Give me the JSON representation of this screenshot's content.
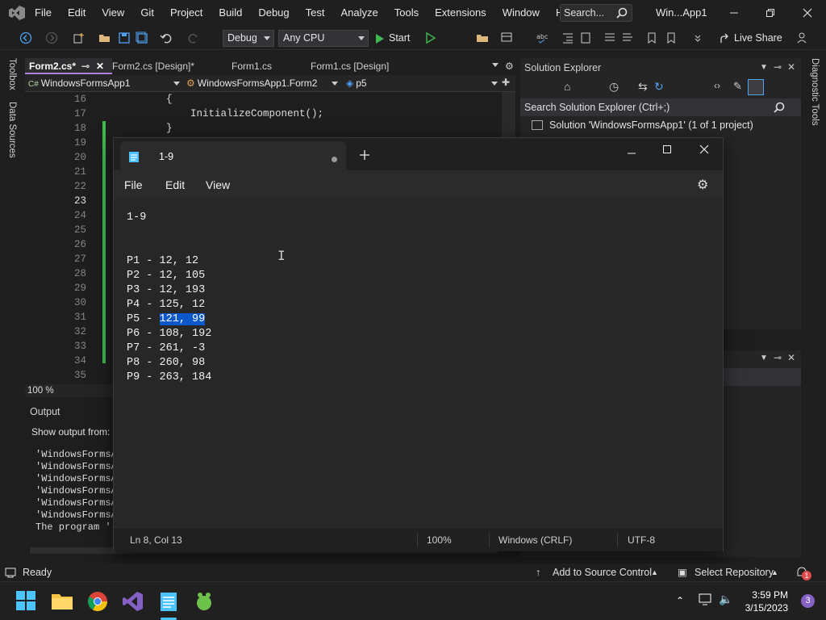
{
  "vs": {
    "menu": [
      "File",
      "Edit",
      "View",
      "Git",
      "Project",
      "Build",
      "Debug",
      "Test",
      "Analyze",
      "Tools",
      "Extensions",
      "Window",
      "Help"
    ],
    "search_placeholder": "Search...",
    "window_title": "Win...App1",
    "config": "Debug",
    "platform": "Any CPU",
    "start_label": "Start",
    "live_share": "Live Share",
    "left_rail": [
      "Toolbox",
      "Data Sources"
    ],
    "right_rail": [
      "Diagnostic Tools"
    ],
    "tabs": [
      "Form2.cs*",
      "Form2.cs [Design]*",
      "Form1.cs",
      "Form1.cs [Design]"
    ],
    "nav": {
      "project": "WindowsFormsApp1",
      "class": "WindowsFormsApp1.Form2",
      "member": "p5"
    },
    "line_numbers": [
      "16",
      "17",
      "18",
      "19",
      "20",
      "21",
      "22",
      "23",
      "24",
      "25",
      "26",
      "27",
      "28",
      "29",
      "30",
      "31",
      "32",
      "33",
      "34",
      "35"
    ],
    "current_line": "23",
    "code": [
      {
        "line": "16",
        "text": "{"
      },
      {
        "line": "17",
        "text": "    InitializeComponent();"
      },
      {
        "line": "18",
        "text": "}"
      }
    ],
    "zoom": "100 %",
    "output": {
      "title": "Output",
      "show_from": "Show output from:",
      "lines": [
        "'WindowsFormsA",
        "'WindowsFormsA",
        "'WindowsFormsA",
        "'WindowsFormsA",
        "'WindowsFormsA",
        "'WindowsFormsA",
        "The program '["
      ]
    },
    "solution_explorer": {
      "title": "Solution Explorer",
      "search": "Search Solution Explorer (Ctrl+;)",
      "root": "Solution 'WindowsFormsApp1' (1 of 1 project)"
    },
    "status": {
      "ready": "Ready",
      "source_control": "Add to Source Control",
      "repository": "Select Repository",
      "notifications": "1"
    }
  },
  "notepad": {
    "tab_title": "1-9",
    "menu": [
      "File",
      "Edit",
      "View"
    ],
    "lines": [
      {
        "pre": "1-9",
        "sel": "",
        "post": ""
      },
      {
        "pre": "",
        "sel": "",
        "post": ""
      },
      {
        "pre": "",
        "sel": "",
        "post": ""
      },
      {
        "pre": "P1 - 12, 12",
        "sel": "",
        "post": ""
      },
      {
        "pre": "P2 - 12, 105",
        "sel": "",
        "post": ""
      },
      {
        "pre": "P3 - 12, 193",
        "sel": "",
        "post": ""
      },
      {
        "pre": "P4 - 125, 12",
        "sel": "",
        "post": ""
      },
      {
        "pre": "P5 - ",
        "sel": "121, 99",
        "post": ""
      },
      {
        "pre": "P6 - 108, 192",
        "sel": "",
        "post": ""
      },
      {
        "pre": "P7 - 261, -3",
        "sel": "",
        "post": ""
      },
      {
        "pre": "P8 - 260, 98",
        "sel": "",
        "post": ""
      },
      {
        "pre": "P9 - 263, 184",
        "sel": "",
        "post": ""
      }
    ],
    "status": {
      "position": "Ln 8, Col 13",
      "zoom": "100%",
      "line_ending": "Windows (CRLF)",
      "encoding": "UTF-8"
    }
  },
  "taskbar": {
    "apps": [
      "start-icon",
      "file-explorer-icon",
      "chrome-icon",
      "visual-studio-icon",
      "notepad-icon",
      "git-icon"
    ],
    "time": "3:59 PM",
    "date": "3/15/2023",
    "notifications": "3"
  },
  "colors": {
    "accent": "#0a58ca",
    "vs_purple": "#b180d7",
    "taskbar": "#202020"
  }
}
